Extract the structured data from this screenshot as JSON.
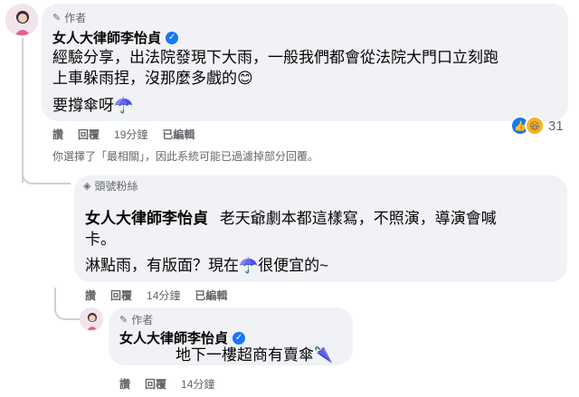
{
  "comment1": {
    "tag": "作者",
    "author": "女人大律師李怡貞",
    "body_line1": "經驗分享，出法院發現下大雨，一般我們都會從法院大門口立刻跑",
    "body_line2": "上車躲雨捏，沒那麼多戲的😊",
    "body_line3": "要撐傘呀☂️",
    "actions": {
      "like": "讚",
      "reply": "回覆",
      "time": "19分鐘",
      "edited": "已編輯"
    },
    "reactions": {
      "count": "31",
      "icons": [
        "like-icon",
        "haha-icon"
      ]
    },
    "filter_notice": "你選擇了「最相關」，因此系統可能已過濾掉部分回覆。"
  },
  "comment2": {
    "tag": "頭號粉絲",
    "author": "女人大律師李怡貞",
    "body_inline": "老天爺劇本都這樣寫，不照演，導演會喊",
    "body_line2": "卡。",
    "body_line3": "淋點雨，有版面？現在☂️很便宜的~",
    "actions": {
      "like": "讚",
      "reply": "回覆",
      "time": "14分鐘",
      "edited": "已編輯"
    }
  },
  "comment3": {
    "tag": "作者",
    "author": "女人大律師李怡貞",
    "body": "地下一樓超商有賣傘🌂",
    "actions": {
      "like": "讚",
      "reply": "回覆",
      "time": "14分鐘"
    }
  },
  "colors": {
    "verified": "#1877f2",
    "bubble": "#f0f2f5",
    "meta": "#65676b"
  }
}
